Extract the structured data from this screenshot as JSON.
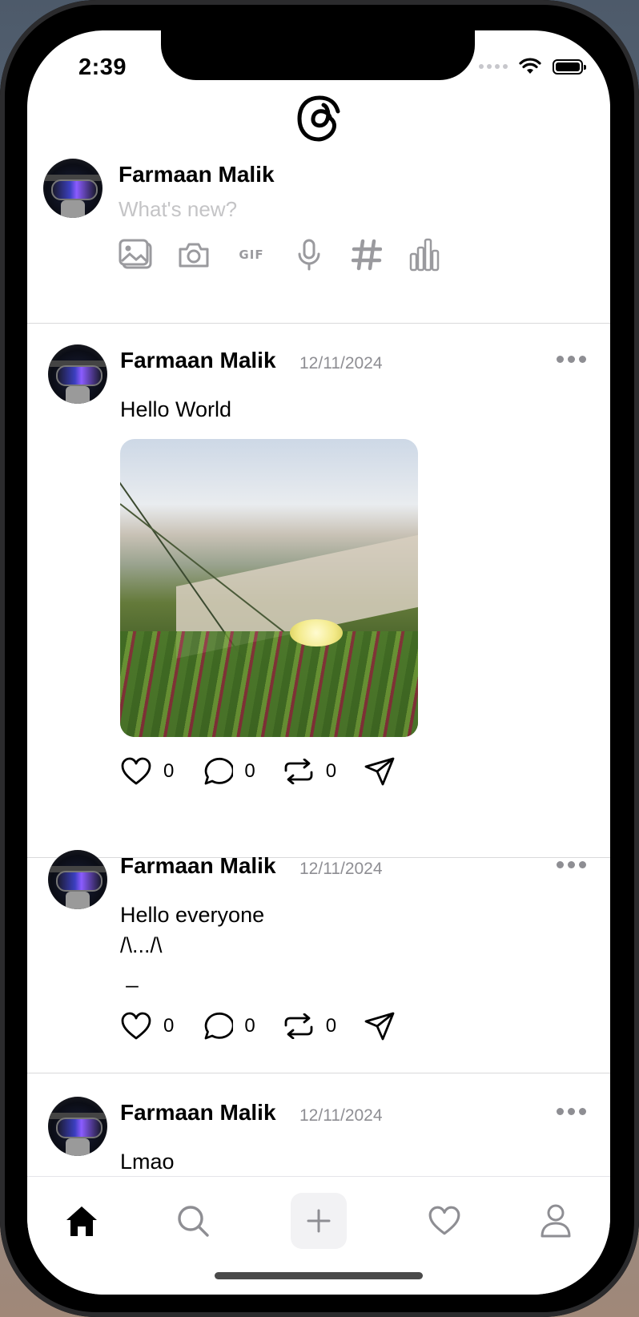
{
  "status_bar": {
    "time": "2:39"
  },
  "composer": {
    "user_name": "Farmaan Malik",
    "placeholder": "What's new?",
    "tools": [
      "image-gallery-icon",
      "camera-icon",
      "gif-icon",
      "microphone-icon",
      "hashtag-icon",
      "poll-icon"
    ],
    "gif_label": "GIF"
  },
  "posts": [
    {
      "author": "Farmaan Malik",
      "date": "12/11/2024",
      "text": "Hello World",
      "has_image": true,
      "likes": "0",
      "comments": "0",
      "reposts": "0"
    },
    {
      "author": "Farmaan Malik",
      "date": "12/11/2024",
      "text": "Hello everyone\n/\\.../\\\n _",
      "has_image": false,
      "likes": "0",
      "comments": "0",
      "reposts": "0"
    },
    {
      "author": "Farmaan Malik",
      "date": "12/11/2024",
      "text": "Lmao",
      "has_image": false
    }
  ],
  "tab_bar": {
    "tabs": [
      "home-icon",
      "search-icon",
      "plus-icon",
      "heart-icon",
      "profile-icon"
    ],
    "active": "home-icon"
  }
}
